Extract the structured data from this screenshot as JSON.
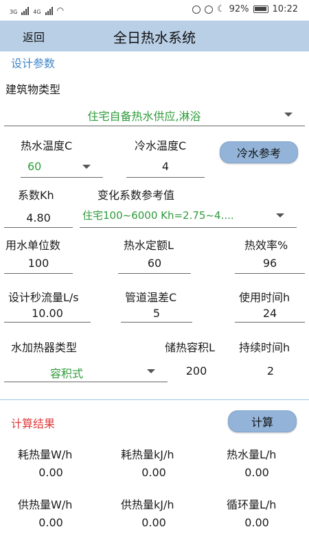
{
  "status": {
    "net1": "3G",
    "net2": "4G",
    "battery": "92%",
    "time": "10:22"
  },
  "header": {
    "back": "返回",
    "title": "全日热水系统"
  },
  "design": {
    "section_title": "设计参数",
    "building_type_label": "建筑物类型",
    "building_type_value": "住宅自备热水供应,淋浴",
    "hot_temp_label": "热水温度C",
    "hot_temp_value": "60",
    "cold_temp_label": "冷水温度C",
    "cold_temp_value": "4",
    "cold_ref_button": "冷水参考",
    "kh_label": "系数Kh",
    "kh_value": "4.80",
    "kh_ref_label": "变化系数参考值",
    "kh_ref_value": "住宅100~6000 Kh=2.75~4....",
    "units_label": "用水单位数",
    "units_value": "100",
    "quota_label": "热水定额L",
    "quota_value": "60",
    "efficiency_label": "热效率%",
    "efficiency_value": "96",
    "flow_label": "设计秒流量L/s",
    "flow_value": "10.00",
    "pipe_temp_label": "管道温差C",
    "pipe_temp_value": "5",
    "use_time_label": "使用时间h",
    "use_time_value": "24",
    "heater_type_label": "水加热器类型",
    "heater_type_value": "容积式",
    "storage_label": "储热容积L",
    "storage_value": "200",
    "duration_label": "持续时间h",
    "duration_value": "2"
  },
  "results": {
    "section_title": "计算结果",
    "calc_button": "计算",
    "heat_w_label": "耗热量W/h",
    "heat_w_value": "0.00",
    "heat_kj_label": "耗热量kJ/h",
    "heat_kj_value": "0.00",
    "hot_water_label": "热水量L/h",
    "hot_water_value": "0.00",
    "supply_w_label": "供热量W/h",
    "supply_w_value": "0.00",
    "supply_kj_label": "供热量kJ/h",
    "supply_kj_value": "0.00",
    "circ_label": "循环量L/h",
    "circ_value": "0.00"
  },
  "colors": {
    "header_bg": "#b9cfe6",
    "button_bg": "#93b4d8",
    "section_blue": "#3f86c7",
    "section_red": "#e03a3a",
    "value_green": "#2e9b3a"
  }
}
